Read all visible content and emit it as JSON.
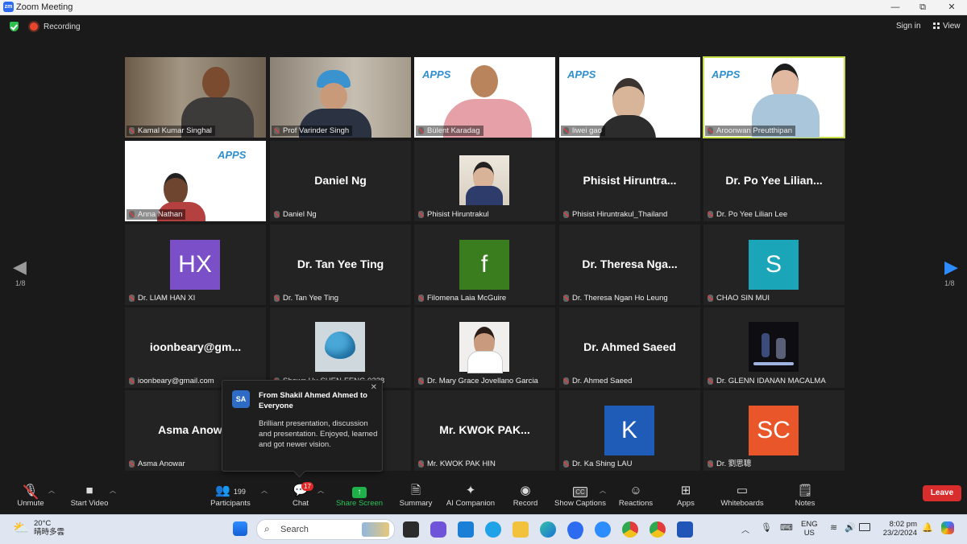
{
  "window": {
    "title": "Zoom Meeting",
    "app_badge": "zm",
    "minimize": "—",
    "maximize": "⧉",
    "close": "✕"
  },
  "topbar": {
    "recording": "Recording",
    "signin": "Sign in",
    "view": "View"
  },
  "pager": {
    "left": "1/8",
    "right": "1/8"
  },
  "tiles": [
    {
      "name": "Kamal Kumar Singhal"
    },
    {
      "name": "Prof Varinder Singh"
    },
    {
      "name": "Bülent Karadag"
    },
    {
      "name": "liwei gao"
    },
    {
      "name": "Aroonwan Preutthipan"
    },
    {
      "name": "Anna Nathan"
    },
    {
      "name": "Daniel Ng",
      "big": "Daniel Ng"
    },
    {
      "name": "Phisist Hiruntrakul"
    },
    {
      "name": "Phisist Hiruntrakul_Thailand",
      "big": "Phisist  Hiruntra..."
    },
    {
      "name": "Dr. Po Yee Lilian Lee",
      "big": "Dr. Po Yee Lilian..."
    },
    {
      "name": "Dr. LIAM HAN XI",
      "initials": "HX",
      "color": "#7b4fc8"
    },
    {
      "name": "Dr. Tan Yee Ting",
      "big": "Dr. Tan Yee Ting"
    },
    {
      "name": "Filomena Laia McGuire",
      "initials": "f",
      "color": "#3a7d1e"
    },
    {
      "name": "Dr. Theresa Ngan Ho Leung",
      "big": "Dr. Theresa Nga..."
    },
    {
      "name": "CHAO SIN MUI",
      "initials": "S",
      "color": "#1aa5b8"
    },
    {
      "name": "ioonbeary@gmail.com",
      "big": "ioonbeary@gm..."
    },
    {
      "name": "Shawn Hu SHEN-FENG 0238"
    },
    {
      "name": "Dr. Mary Grace Jovellano Garcia"
    },
    {
      "name": "Dr. Ahmed Saeed",
      "big": "Dr. Ahmed Saeed"
    },
    {
      "name": "Dr. GLENN IDANAN MACALMA"
    },
    {
      "name": "Asma Anowar",
      "big": "Asma Anowar"
    },
    {
      "name": ""
    },
    {
      "name": "Mr. KWOK PAK HIN",
      "big": "Mr.  KWOK  PAK..."
    },
    {
      "name": "Dr. Ka Shing LAU",
      "initials": "K",
      "color": "#1e5cb8"
    },
    {
      "name": "Dr. 劉思聰",
      "initials": "SC",
      "color": "#e8562a"
    }
  ],
  "apps_logo": "APPS",
  "chat_popup": {
    "avatar": "SA",
    "from": "From Shakil Ahmed Ahmed to Everyone",
    "message": "Brilliant presentation, discussion and presentation. Enjoyed, learned and got newer vision.",
    "close": "✕"
  },
  "toolbar": {
    "unmute": "Unmute",
    "start_video": "Start Video",
    "participants": "Participants",
    "participants_count": "199",
    "chat": "Chat",
    "chat_badge": "17",
    "share_screen": "Share Screen",
    "summary": "Summary",
    "ai_companion": "AI Companion",
    "record": "Record",
    "show_captions": "Show Captions",
    "reactions": "Reactions",
    "apps": "Apps",
    "whiteboards": "Whiteboards",
    "notes": "Notes",
    "leave": "Leave",
    "cc": "CC"
  },
  "taskbar": {
    "temp": "20°C",
    "weather": "晴時多雲",
    "search": "Search",
    "lang1": "ENG",
    "lang2": "US",
    "time": "8:02 pm",
    "date": "23/2/2024"
  }
}
